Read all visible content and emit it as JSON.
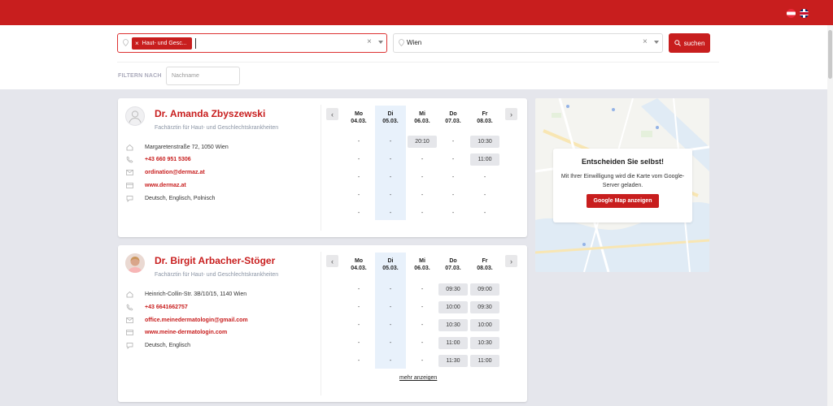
{
  "header": {
    "languages": [
      {
        "code": "de-AT",
        "icon": "flag-austria-icon"
      },
      {
        "code": "en",
        "icon": "flag-uk-icon"
      }
    ]
  },
  "search": {
    "specialty_chip": "Haut- und Gesc...",
    "location_value": "Wien",
    "search_button": "suchen"
  },
  "filter": {
    "label": "FILTERN NACH",
    "lastname_placeholder": "Nachname"
  },
  "days": [
    {
      "name": "Mo",
      "date": "04.03."
    },
    {
      "name": "Di",
      "date": "05.03."
    },
    {
      "name": "Mi",
      "date": "06.03."
    },
    {
      "name": "Do",
      "date": "07.03."
    },
    {
      "name": "Fr",
      "date": "08.03."
    }
  ],
  "doctors": [
    {
      "name": "Dr. Amanda Zbyszewski",
      "specialty": "Fachärztin für Haut- und Geschlechtskrankheiten",
      "address": "Margaretenstraße 72, 1050 Wien",
      "phone": "+43 660 951 5306",
      "email": "ordination@dermaz.at",
      "website": "www.dermaz.at",
      "languages": "Deutsch, Englisch, Polnisch",
      "slots": [
        [
          "-",
          "-",
          "20:10",
          "-",
          "10:30"
        ],
        [
          "-",
          "-",
          "-",
          "-",
          "11:00"
        ],
        [
          "-",
          "-",
          "-",
          "-",
          "-"
        ],
        [
          "-",
          "-",
          "-",
          "-",
          "-"
        ],
        [
          "-",
          "-",
          "-",
          "-",
          "-"
        ]
      ]
    },
    {
      "name": "Dr. Birgit Arbacher-Stöger",
      "specialty": "Fachärztin für Haut- und Geschlechtskrankheiten",
      "address": "Heinrich-Collin-Str. 3B/10/15, 1140 Wien",
      "phone": "+43 6641662757",
      "email": "office.meinedermatologin@gmail.com",
      "website": "www.meine-dermatologin.com",
      "languages": "Deutsch, Englisch",
      "slots": [
        [
          "-",
          "-",
          "-",
          "09:30",
          "09:00"
        ],
        [
          "-",
          "-",
          "-",
          "10:00",
          "09:30"
        ],
        [
          "-",
          "-",
          "-",
          "10:30",
          "10:00"
        ],
        [
          "-",
          "-",
          "-",
          "11:00",
          "10:30"
        ],
        [
          "-",
          "-",
          "-",
          "11:30",
          "11:00"
        ]
      ],
      "more_link": "mehr anzeigen"
    }
  ],
  "map": {
    "title": "Entscheiden Sie selbst!",
    "text": "Mit Ihrer Einwilligung wird die Karte vom Google-Server geladen.",
    "button": "Google Map anzeigen"
  },
  "colors": {
    "brand_red": "#c81e1e",
    "today_column": "#e8f1fb",
    "page_bg": "#e5e6ec"
  }
}
